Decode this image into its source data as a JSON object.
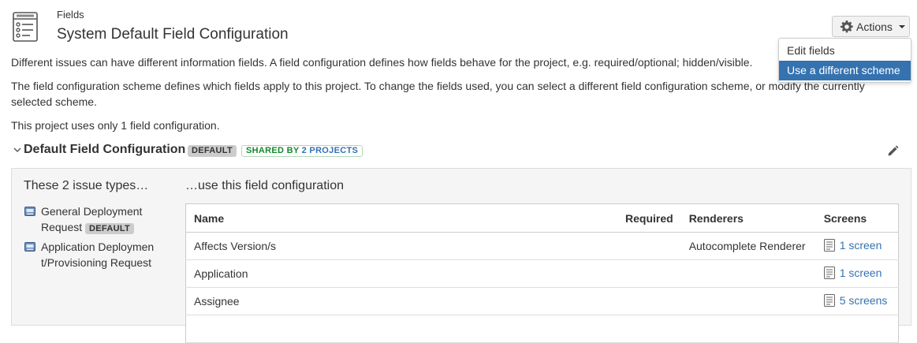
{
  "header": {
    "breadcrumb": "Fields",
    "title": "System Default Field Configuration"
  },
  "actions": {
    "label": "Actions",
    "menu": [
      {
        "label": "Edit fields"
      },
      {
        "label": "Use a different scheme"
      }
    ]
  },
  "description": {
    "p1": "Different issues can have different information fields. A field configuration defines how fields behave for the project, e.g. required/optional; hidden/visible.",
    "p2": "The field configuration scheme defines which fields apply to this project. To change the fields used, you can select a different field configuration scheme, or modify the currently selected scheme.",
    "p3": "This project uses only 1 field configuration."
  },
  "section": {
    "title": "Default Field Configuration",
    "default_badge": "DEFAULT",
    "shared_prefix": "SHARED BY ",
    "shared_link": "2 PROJECTS"
  },
  "issue_types": {
    "heading": "These 2 issue types…",
    "items": [
      {
        "name": "General Deployment Request",
        "badge": "DEFAULT"
      },
      {
        "name": "Application Deployment/Provisioning Request"
      }
    ]
  },
  "fields_table": {
    "heading": "…use this field configuration",
    "columns": [
      "Name",
      "Required",
      "Renderers",
      "Screens"
    ],
    "rows": [
      {
        "name": "Affects Version/s",
        "required": "",
        "renderer": "Autocomplete Renderer",
        "screens": "1 screen"
      },
      {
        "name": "Application",
        "required": "",
        "renderer": "",
        "screens": "1 screen"
      },
      {
        "name": "Assignee",
        "required": "",
        "renderer": "",
        "screens": "5 screens"
      }
    ]
  },
  "colors": {
    "link": "#3572b0",
    "menu_highlight": "#3572b0",
    "shared_green": "#14892c"
  },
  "icons": [
    "field-config-icon",
    "gear-icon",
    "chevron-down-icon",
    "pencil-icon",
    "issue-type-icon",
    "screen-icon"
  ]
}
